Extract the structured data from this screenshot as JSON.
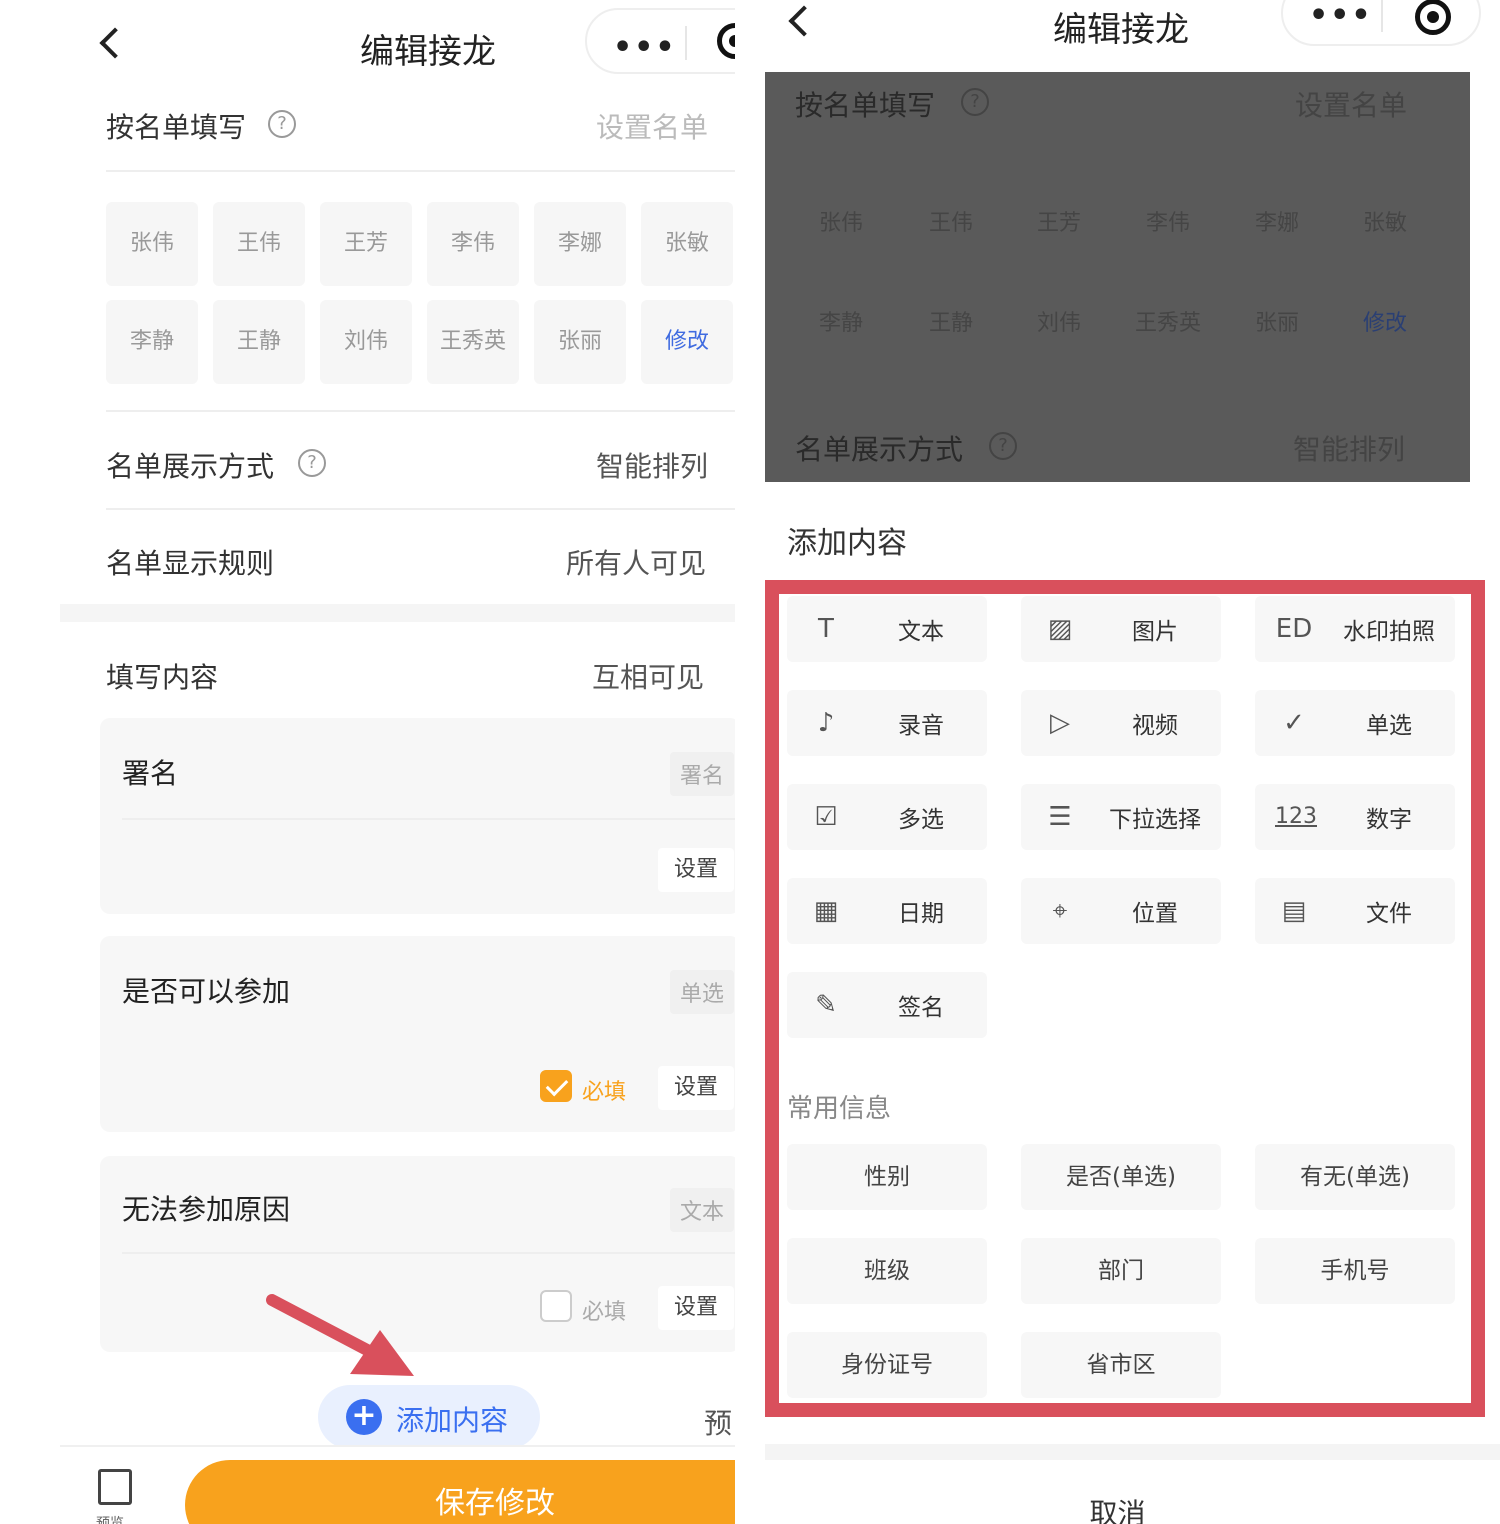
{
  "nav": {
    "title": "编辑接龙",
    "dots": "•••"
  },
  "left": {
    "roster_label": "按名单填写",
    "roster_help": "?",
    "roster_value": "设置名单",
    "names_row1": [
      "张伟",
      "王伟",
      "王芳",
      "李伟",
      "李娜",
      "张敏"
    ],
    "names_row2": [
      "李静",
      "王静",
      "刘伟",
      "王秀英",
      "张丽"
    ],
    "modify": "修改",
    "display_label": "名单展示方式",
    "display_value": "智能排列",
    "rule_label": "名单显示规则",
    "rule_value": "所有人可见",
    "fill_label": "填写内容",
    "fill_value": "互相可见",
    "cards": [
      {
        "title": "署名",
        "tag": "署名",
        "settings": "设置"
      },
      {
        "title": "是否可以参加",
        "tag": "单选",
        "required": "必填",
        "required_checked": true,
        "settings": "设置"
      },
      {
        "title": "无法参加原因",
        "tag": "文本",
        "required": "必填",
        "required_checked": false,
        "settings": "设置"
      }
    ],
    "add_content": "添加内容",
    "preview_partial": "预",
    "preview_bottom": "预览",
    "save": "保存修改"
  },
  "right": {
    "roster_label": "按名单填写",
    "roster_value": "设置名单",
    "display_label": "名单展示方式",
    "display_value": "智能排列",
    "sheet_title": "添加内容",
    "items": [
      {
        "icon": "T",
        "label": "文本",
        "icon_name": "text-icon"
      },
      {
        "icon": "▨",
        "label": "图片",
        "icon_name": "image-icon"
      },
      {
        "icon": "ED",
        "label": "水印拍照",
        "icon_name": "watermark-icon"
      },
      {
        "icon": "♪",
        "label": "录音",
        "icon_name": "microphone-icon"
      },
      {
        "icon": "▷",
        "label": "视频",
        "icon_name": "video-icon"
      },
      {
        "icon": "✓",
        "label": "单选",
        "icon_name": "radio-icon"
      },
      {
        "icon": "☑",
        "label": "多选",
        "icon_name": "checkbox-icon"
      },
      {
        "icon": "☰",
        "label": "下拉选择",
        "icon_name": "dropdown-icon"
      },
      {
        "icon": "123",
        "label": "数字",
        "icon_name": "number-icon"
      },
      {
        "icon": "▦",
        "label": "日期",
        "icon_name": "calendar-icon"
      },
      {
        "icon": "⌖",
        "label": "位置",
        "icon_name": "location-icon"
      },
      {
        "icon": "▤",
        "label": "文件",
        "icon_name": "file-icon"
      },
      {
        "icon": "✎",
        "label": "签名",
        "icon_name": "signature-icon"
      }
    ],
    "common_title": "常用信息",
    "common": [
      "性别",
      "是否(单选)",
      "有无(单选)",
      "班级",
      "部门",
      "手机号",
      "身份证号",
      "省市区"
    ],
    "cancel": "取消"
  },
  "colors": {
    "accent": "#f8a21d",
    "blue": "#3a6ff0",
    "highlight": "#d9505c"
  }
}
